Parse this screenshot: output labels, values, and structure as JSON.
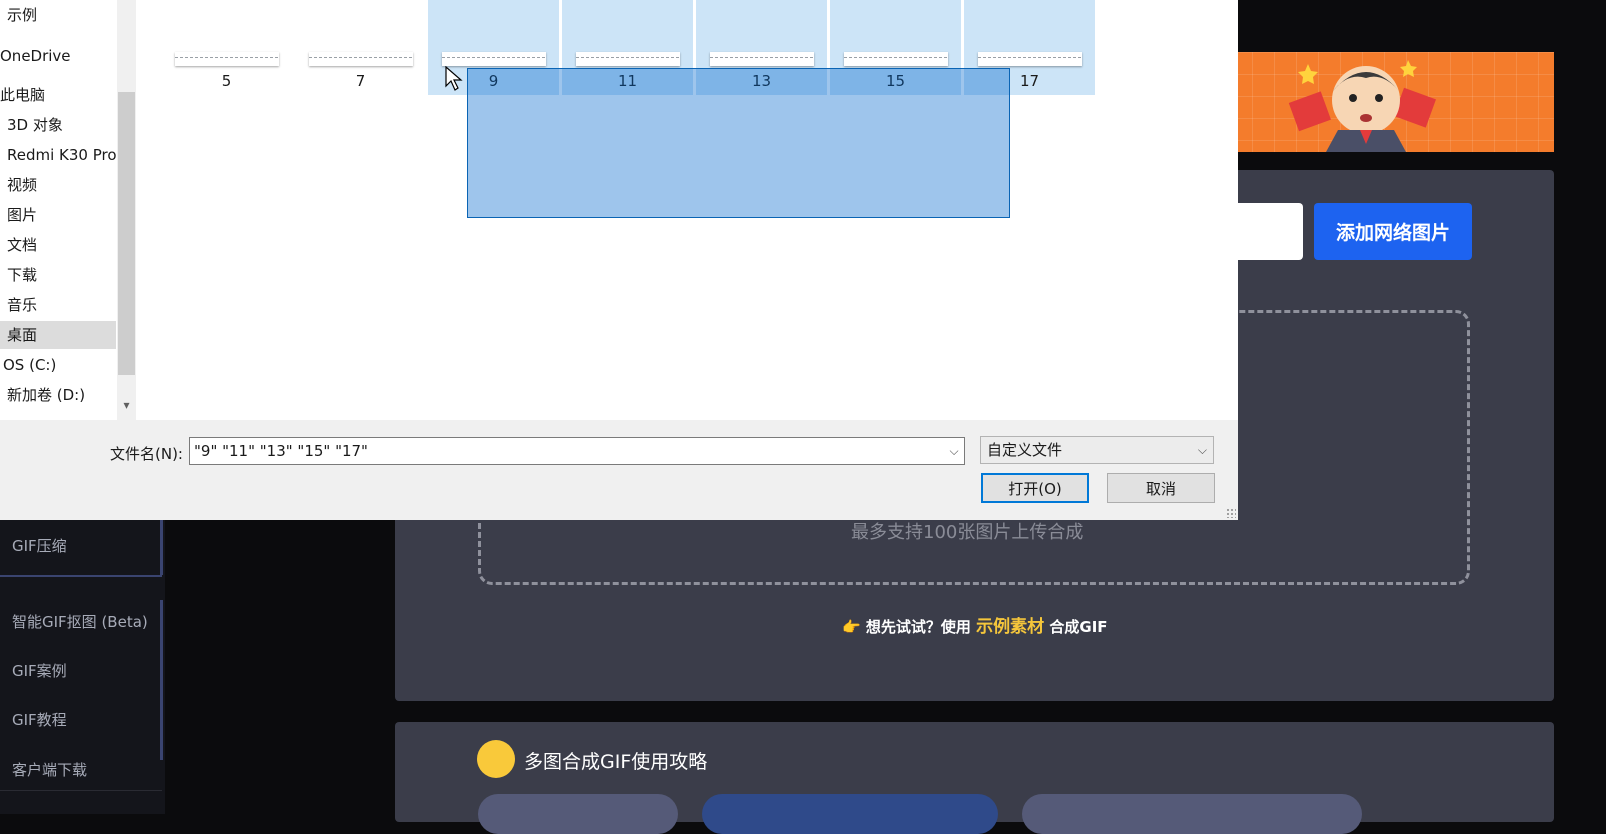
{
  "web": {
    "sidebar_items": [
      "GIF压缩",
      "智能GIF抠图 (Beta)",
      "GIF案例",
      "GIF教程",
      "客户端下载"
    ],
    "add_url_button": "添加网络图片",
    "dropzone_hint": "最多支持100张图片上传合成",
    "try_prefix": "想先试试？使用",
    "try_link": "示例素材",
    "try_suffix": "合成GIF",
    "guide_title": "多图合成GIF使用攻略"
  },
  "dialog": {
    "nav_items": [
      "示例",
      "OneDrive",
      "此电脑",
      "3D 对象",
      "Redmi K30 Pro",
      "视频",
      "图片",
      "文档",
      "下载",
      "音乐",
      "桌面",
      "OS (C:)",
      "新加卷 (D:)"
    ],
    "selected_nav": "桌面",
    "files": [
      {
        "name": "5",
        "selected": false
      },
      {
        "name": "7",
        "selected": false
      },
      {
        "name": "9",
        "selected": true
      },
      {
        "name": "11",
        "selected": true
      },
      {
        "name": "13",
        "selected": true
      },
      {
        "name": "15",
        "selected": true
      },
      {
        "name": "17",
        "selected": true
      }
    ],
    "filename_label": "文件名(N):",
    "filename_value": "\"9\" \"11\" \"13\" \"15\" \"17\"",
    "filetype": "自定义文件",
    "open_button": "打开(O)",
    "cancel_button": "取消"
  },
  "colors": {
    "accent_button": "#1d63f0",
    "selection": "#cce4f7",
    "highlight_text": "#f5c63b"
  }
}
